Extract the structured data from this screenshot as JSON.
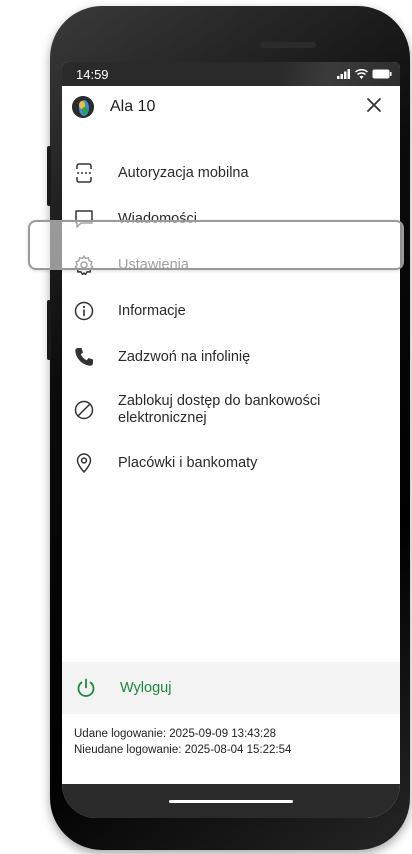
{
  "status_bar": {
    "time": "14:59",
    "icons": [
      "signal-icon",
      "wifi-icon",
      "battery-icon"
    ]
  },
  "header": {
    "user_name": "Ala 10",
    "avatar_icon": "parrot-avatar-icon",
    "close_icon": "close-icon"
  },
  "menu": {
    "items": [
      {
        "label": "Autoryzacja mobilna",
        "icon": "mobile-authorization-icon"
      },
      {
        "label": "Wiadomości",
        "icon": "message-icon"
      },
      {
        "label": "Ustawienia",
        "icon": "gear-icon"
      },
      {
        "label": "Informacje",
        "icon": "info-icon"
      },
      {
        "label": "Zadzwoń na infolinię",
        "icon": "phone-icon"
      },
      {
        "label": "Zablokuj dostęp do bankowości elektronicznej",
        "icon": "block-icon"
      },
      {
        "label": "Placówki i bankomaty",
        "icon": "location-pin-icon"
      }
    ]
  },
  "logout": {
    "label": "Wyloguj",
    "icon": "power-icon"
  },
  "login_info": {
    "success": "Udane logowanie: 2025-09-09 13:43:28",
    "failed": "Nieudane logowanie: 2025-08-04 15:22:54"
  },
  "colors": {
    "accent_green": "#1a8a3a",
    "text_dark": "#2a2a2a",
    "phone_frame": "#000000"
  }
}
